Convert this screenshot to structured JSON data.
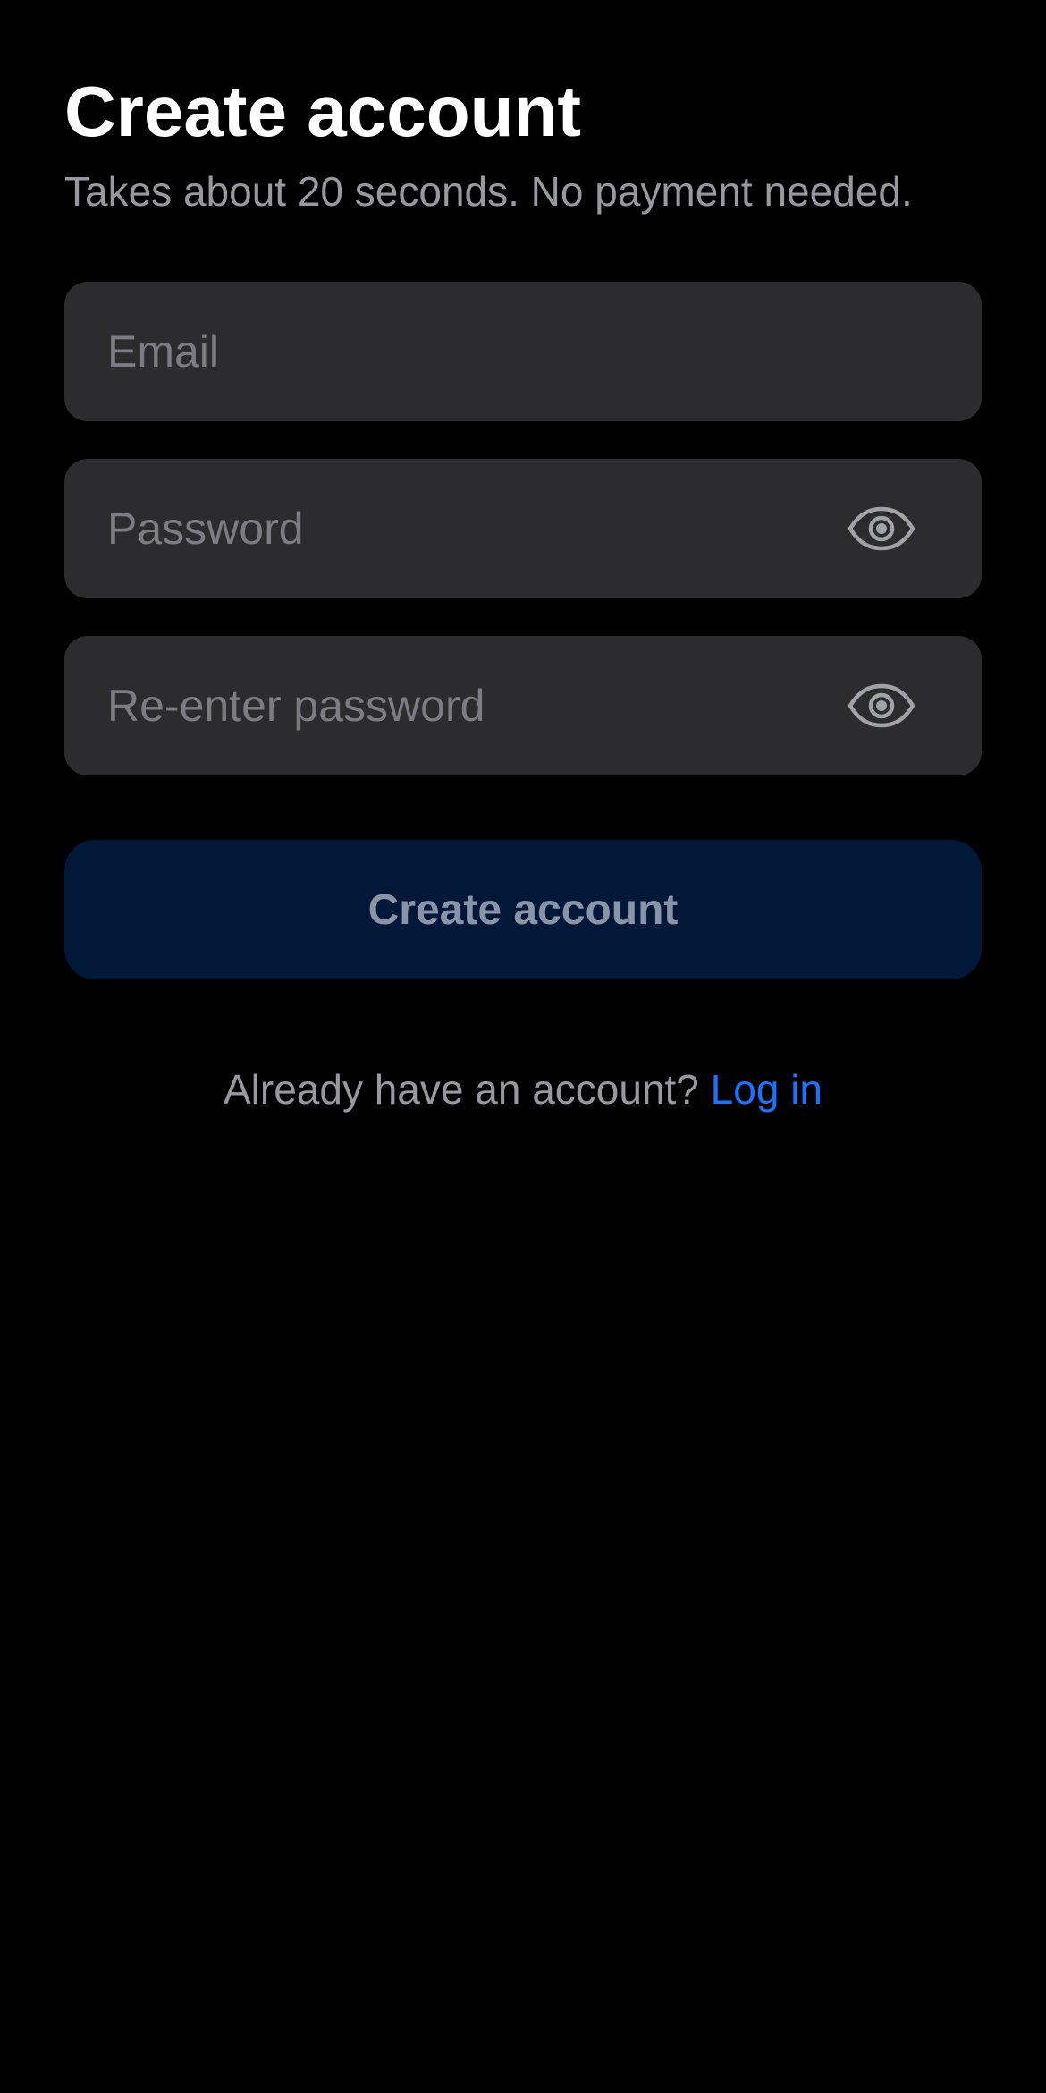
{
  "page": {
    "title": "Create account",
    "subtitle": "Takes about 20 seconds. No payment needed."
  },
  "form": {
    "email": {
      "value": "",
      "placeholder": "Email"
    },
    "password": {
      "value": "",
      "placeholder": "Password",
      "toggle_icon": "eye-icon"
    },
    "confirm_password": {
      "value": "",
      "placeholder": "Re-enter password",
      "toggle_icon": "eye-icon"
    },
    "submit_label": "Create account"
  },
  "footer": {
    "prompt": "Already have an account?",
    "link_label": "Log in"
  },
  "colors": {
    "background": "#000000",
    "field_background": "#2c2c2e",
    "button_background": "#011839",
    "link": "#1a73ff"
  }
}
